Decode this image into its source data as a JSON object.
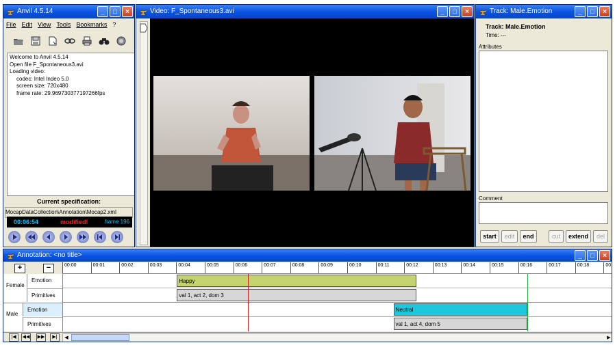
{
  "main_window": {
    "title": "Anvil 4.5.14",
    "menu": [
      "File",
      "Edit",
      "View",
      "Tools",
      "Bookmarks",
      "?"
    ],
    "toolbar_icons": [
      "open-folder-icon",
      "save-icon",
      "new-document-icon",
      "link-icon",
      "print-icon",
      "binoculars-icon",
      "globe-icon"
    ],
    "log_lines": [
      "Welcome to Anvil 4.5.14",
      "Open file F_Spontaneous3.avi",
      "Loading video:",
      "    codec: Intel Indeo 5.0",
      "    screen size: 720x480",
      "    frame rate: 29.969730377197266fps"
    ],
    "spec_label": "Current specification:",
    "spec_path": "MocapDataCollection\\Annotation\\Mocap2.xml",
    "timecode": "00:06:54",
    "modified": "modified!",
    "frame": "frame 196"
  },
  "video_window": {
    "title": "Video: F_Spontaneous3.avi"
  },
  "track_window": {
    "title": "Track: Male.Emotion",
    "track_name": "Track: Male.Emotion",
    "time": "Time: ---",
    "attributes_label": "Attributes",
    "comment_label": "Comment",
    "buttons": [
      "start",
      "edit",
      "end",
      "cut",
      "extend",
      "del"
    ],
    "enabled": [
      true,
      false,
      true,
      false,
      true,
      false
    ]
  },
  "annotation_window": {
    "title": "Annotation: <no title>",
    "ticks": [
      "00:00",
      "00:01",
      "00:02",
      "00:03",
      "00:04",
      "00:05",
      "00:06",
      "00:07",
      "00:08",
      "00:09",
      "00:10",
      "00:11",
      "00:12",
      "00:13",
      "00:14",
      "00:15",
      "00:16",
      "00:17",
      "00:18",
      "00"
    ],
    "groups": [
      {
        "name": "Female",
        "tracks": [
          "Emotion",
          "Primitives"
        ]
      },
      {
        "name": "Male",
        "tracks": [
          "Emotion",
          "Primitives"
        ]
      }
    ],
    "elements": [
      {
        "track": 0,
        "label": "Happy",
        "start": 4.0,
        "end": 12.4,
        "color": "#c5d36f"
      },
      {
        "track": 1,
        "label": "val 1, act 2, dom 3",
        "start": 4.0,
        "end": 12.4,
        "color": "#d7d7d7"
      },
      {
        "track": 2,
        "label": "Neutral",
        "start": 11.6,
        "end": 16.3,
        "color": "#1ec8dc"
      },
      {
        "track": 3,
        "label": "val 1, act 4, dom 5",
        "start": 11.6,
        "end": 16.3,
        "color": "#d7d7d7"
      }
    ],
    "cursor_red": 6.5,
    "cursor_green": 16.3
  }
}
